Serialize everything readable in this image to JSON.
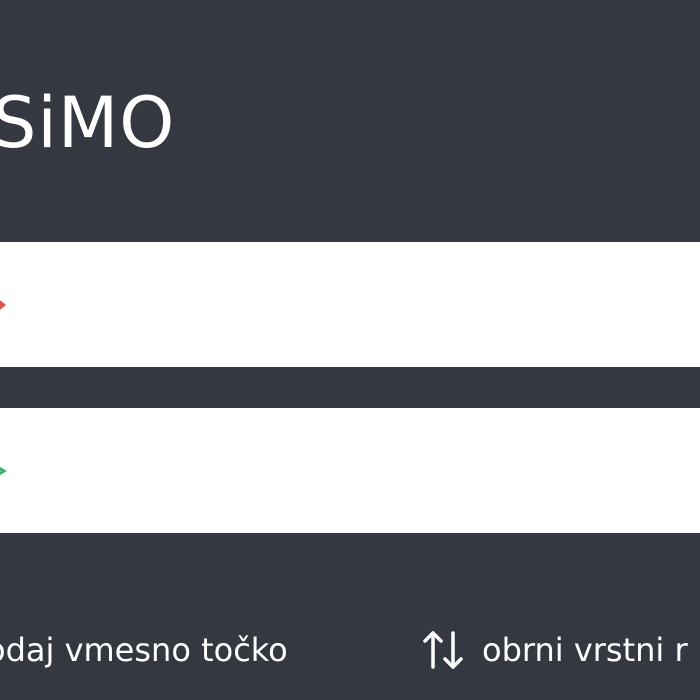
{
  "app": {
    "brand": "SiMO"
  },
  "route": {
    "start": {
      "value": "",
      "placeholder": "",
      "marker_color": "#d9534f"
    },
    "end": {
      "value": "",
      "placeholder": "",
      "marker_color": "#3cae6b"
    }
  },
  "actions": {
    "add_waypoint_label": "odaj vmesno točko",
    "reverse_label": "obrni vrstni r",
    "reverse_icon": "swap-vertical-icon"
  },
  "colors": {
    "background": "#343840",
    "field": "#ffffff",
    "text": "#ffffff"
  }
}
